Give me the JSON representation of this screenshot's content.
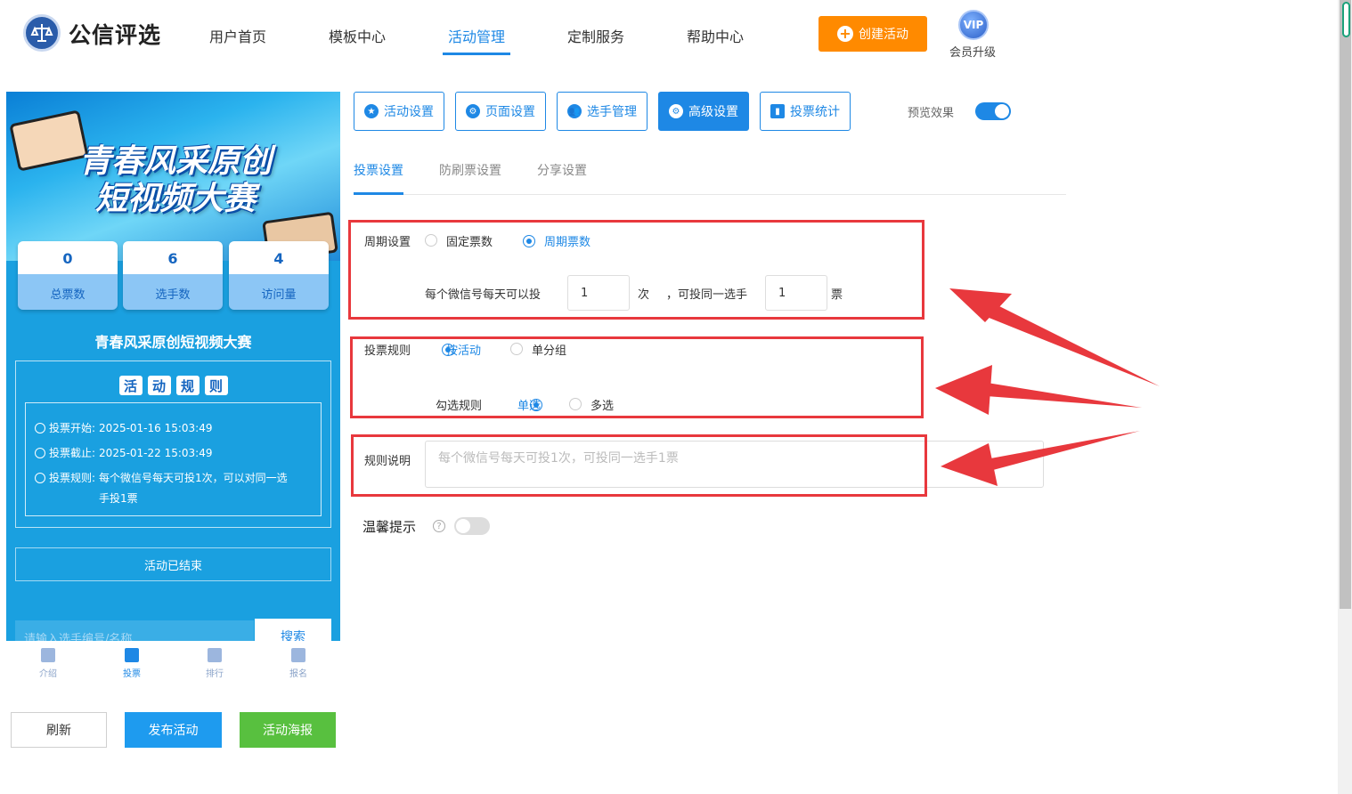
{
  "header": {
    "logo_text": "公信评选",
    "nav": [
      "用户首页",
      "模板中心",
      "活动管理",
      "定制服务",
      "帮助中心"
    ],
    "active_nav": "活动管理",
    "create_button": "创建活动",
    "vip_badge": "VIP",
    "vip_label": "会员升级"
  },
  "preview": {
    "banner_title_line1": "青春风采原创",
    "banner_title_line2": "短视频大赛",
    "stats": [
      {
        "value": "0",
        "label": "总票数"
      },
      {
        "value": "6",
        "label": "选手数"
      },
      {
        "value": "4",
        "label": "访问量"
      }
    ],
    "contest_name": "青春风采原创短视频大赛",
    "rules_title_chars": [
      "活",
      "动",
      "规",
      "则"
    ],
    "rules": [
      {
        "label": "投票开始:",
        "value": "2025-01-16 15:03:49"
      },
      {
        "label": "投票截止:",
        "value": "2025-01-22 15:03:49"
      },
      {
        "label": "投票规则:",
        "value": "每个微信号每天可投1次，可以对同一选手投1票"
      }
    ],
    "ended_text": "活动已结束",
    "search_placeholder": "请输入选手编号/名称",
    "search_button": "搜索",
    "bottom_nav": [
      "介绍",
      "投票",
      "排行",
      "报名"
    ],
    "active_bottom_nav": "投票"
  },
  "actions": {
    "refresh": "刷新",
    "publish": "发布活动",
    "poster": "活动海报"
  },
  "toolbar": {
    "buttons": [
      "活动设置",
      "页面设置",
      "选手管理",
      "高级设置",
      "投票统计"
    ],
    "active": "高级设置",
    "preview_label": "预览效果",
    "preview_on": true
  },
  "subtabs": [
    "投票设置",
    "防刷票设置",
    "分享设置"
  ],
  "active_subtab": "投票设置",
  "form": {
    "cycle_label": "周期设置",
    "cycle_options": [
      "固定票数",
      "周期票数"
    ],
    "cycle_selected": "周期票数",
    "per_day_text": "每个微信号每天可以投",
    "per_day_value": "1",
    "times_unit": "次",
    "same_player_text": "，可投同一选手",
    "same_player_value": "1",
    "votes_unit": "票",
    "rule_label": "投票规则",
    "rule_options": [
      "按活动",
      "单分组"
    ],
    "rule_selected": "按活动",
    "check_label": "勾选规则",
    "check_options": [
      "单选",
      "多选"
    ],
    "check_selected": "单选",
    "desc_label": "规则说明",
    "desc_placeholder": "每个微信号每天可投1次，可投同一选手1票",
    "tip_label": "温馨提示",
    "tip_on": false
  },
  "colors": {
    "accent": "#1e88e5",
    "orange": "#ff8a00",
    "green": "#58c03f",
    "highlight_red": "#e8383d"
  }
}
